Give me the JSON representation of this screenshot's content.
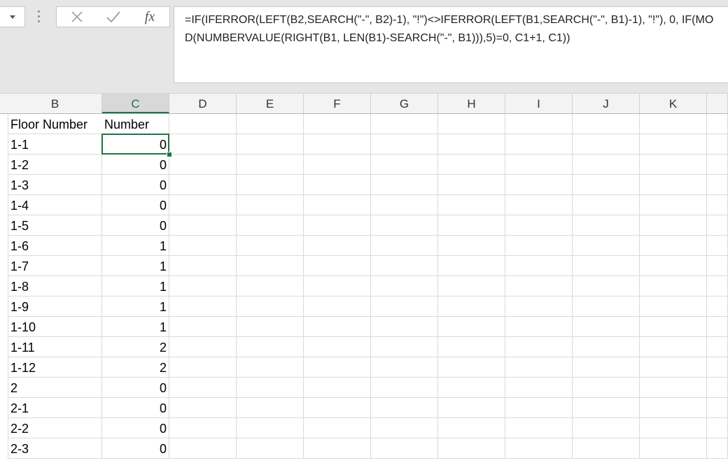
{
  "formula_bar": {
    "cancel_icon": "x-icon",
    "enter_icon": "check-icon",
    "insert_function_label": "fx",
    "formula": "=IF(IFERROR(LEFT(B2,SEARCH(\"-\", B2)-1), \"!\")<>IFERROR(LEFT(B1,SEARCH(\"-\", B1)-1), \"!\"), 0, IF(MOD(NUMBERVALUE(RIGHT(B1, LEN(B1)-SEARCH(\"-\", B1))),5)=0, C1+1, C1))"
  },
  "columns": [
    "B",
    "C",
    "D",
    "E",
    "F",
    "G",
    "H",
    "I",
    "J",
    "K"
  ],
  "active_column": "C",
  "rows": [
    {
      "b": "Floor Number",
      "c": "Number"
    },
    {
      "b": "1-1",
      "c": "0"
    },
    {
      "b": "1-2",
      "c": "0"
    },
    {
      "b": "1-3",
      "c": "0"
    },
    {
      "b": "1-4",
      "c": "0"
    },
    {
      "b": "1-5",
      "c": "0"
    },
    {
      "b": "1-6",
      "c": "1"
    },
    {
      "b": "1-7",
      "c": "1"
    },
    {
      "b": "1-8",
      "c": "1"
    },
    {
      "b": "1-9",
      "c": "1"
    },
    {
      "b": "1-10",
      "c": "1"
    },
    {
      "b": "1-11",
      "c": "2"
    },
    {
      "b": "1-12",
      "c": "2"
    },
    {
      "b": "2",
      "c": "0"
    },
    {
      "b": "2-1",
      "c": "0"
    },
    {
      "b": "2-2",
      "c": "0"
    },
    {
      "b": "2-3",
      "c": "0"
    }
  ],
  "colors": {
    "accent": "#217346"
  }
}
